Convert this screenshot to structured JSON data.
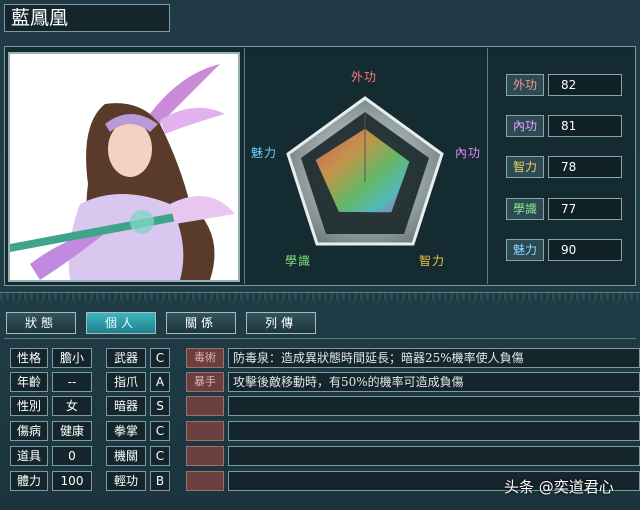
{
  "character": {
    "name": "藍鳳凰"
  },
  "radar": {
    "labels": [
      "外功",
      "內功",
      "智力",
      "學識",
      "魅力"
    ],
    "values": [
      82,
      81,
      78,
      77,
      90
    ]
  },
  "stats": [
    {
      "label": "外功",
      "value": "82"
    },
    {
      "label": "內功",
      "value": "81"
    },
    {
      "label": "智力",
      "value": "78"
    },
    {
      "label": "學識",
      "value": "77"
    },
    {
      "label": "魅力",
      "value": "90"
    }
  ],
  "tabs": [
    "狀態",
    "個人",
    "關係",
    "列傳"
  ],
  "active_tab": "個人",
  "attributes": [
    {
      "label": "性格",
      "value": "膽小"
    },
    {
      "label": "年齡",
      "value": "--"
    },
    {
      "label": "性別",
      "value": "女"
    },
    {
      "label": "傷病",
      "value": "健康"
    },
    {
      "label": "道具",
      "value": "0"
    },
    {
      "label": "體力",
      "value": "100"
    }
  ],
  "skills": [
    {
      "label": "武器",
      "grade": "C"
    },
    {
      "label": "指爪",
      "grade": "A"
    },
    {
      "label": "暗器",
      "grade": "S"
    },
    {
      "label": "拳掌",
      "grade": "C"
    },
    {
      "label": "機關",
      "grade": "C"
    },
    {
      "label": "輕功",
      "grade": "B"
    }
  ],
  "items": [
    {
      "icon": "毒術",
      "desc": "防毒泉：造成異狀態時間延長；暗器25%機率使人負傷"
    },
    {
      "icon": "暴手",
      "desc": "攻擊後敵移動時，有50%的機率可造成負傷"
    },
    {
      "icon": "",
      "desc": ""
    },
    {
      "icon": "",
      "desc": ""
    },
    {
      "icon": "",
      "desc": ""
    },
    {
      "icon": "",
      "desc": ""
    }
  ],
  "watermark": "头条 @奕道君心",
  "colors": {
    "accent": "#3fb5c0",
    "radar_label": "#ff7a7a"
  }
}
